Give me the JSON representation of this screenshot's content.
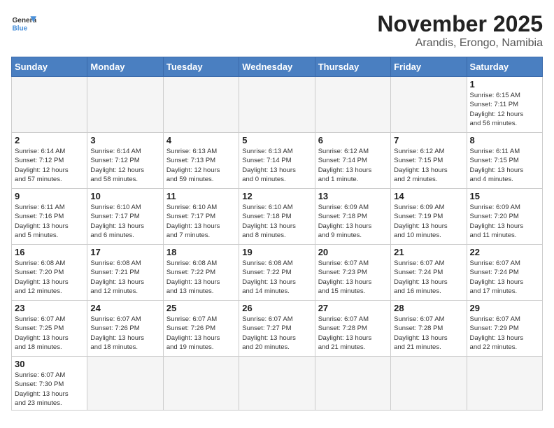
{
  "header": {
    "logo_general": "General",
    "logo_blue": "Blue",
    "month_title": "November 2025",
    "location": "Arandis, Erongo, Namibia"
  },
  "weekdays": [
    "Sunday",
    "Monday",
    "Tuesday",
    "Wednesday",
    "Thursday",
    "Friday",
    "Saturday"
  ],
  "weeks": [
    [
      {
        "day": "",
        "info": ""
      },
      {
        "day": "",
        "info": ""
      },
      {
        "day": "",
        "info": ""
      },
      {
        "day": "",
        "info": ""
      },
      {
        "day": "",
        "info": ""
      },
      {
        "day": "",
        "info": ""
      },
      {
        "day": "1",
        "info": "Sunrise: 6:15 AM\nSunset: 7:11 PM\nDaylight: 12 hours\nand 56 minutes."
      }
    ],
    [
      {
        "day": "2",
        "info": "Sunrise: 6:14 AM\nSunset: 7:12 PM\nDaylight: 12 hours\nand 57 minutes."
      },
      {
        "day": "3",
        "info": "Sunrise: 6:14 AM\nSunset: 7:12 PM\nDaylight: 12 hours\nand 58 minutes."
      },
      {
        "day": "4",
        "info": "Sunrise: 6:13 AM\nSunset: 7:13 PM\nDaylight: 12 hours\nand 59 minutes."
      },
      {
        "day": "5",
        "info": "Sunrise: 6:13 AM\nSunset: 7:14 PM\nDaylight: 13 hours\nand 0 minutes."
      },
      {
        "day": "6",
        "info": "Sunrise: 6:12 AM\nSunset: 7:14 PM\nDaylight: 13 hours\nand 1 minute."
      },
      {
        "day": "7",
        "info": "Sunrise: 6:12 AM\nSunset: 7:15 PM\nDaylight: 13 hours\nand 2 minutes."
      },
      {
        "day": "8",
        "info": "Sunrise: 6:11 AM\nSunset: 7:15 PM\nDaylight: 13 hours\nand 4 minutes."
      }
    ],
    [
      {
        "day": "9",
        "info": "Sunrise: 6:11 AM\nSunset: 7:16 PM\nDaylight: 13 hours\nand 5 minutes."
      },
      {
        "day": "10",
        "info": "Sunrise: 6:10 AM\nSunset: 7:17 PM\nDaylight: 13 hours\nand 6 minutes."
      },
      {
        "day": "11",
        "info": "Sunrise: 6:10 AM\nSunset: 7:17 PM\nDaylight: 13 hours\nand 7 minutes."
      },
      {
        "day": "12",
        "info": "Sunrise: 6:10 AM\nSunset: 7:18 PM\nDaylight: 13 hours\nand 8 minutes."
      },
      {
        "day": "13",
        "info": "Sunrise: 6:09 AM\nSunset: 7:18 PM\nDaylight: 13 hours\nand 9 minutes."
      },
      {
        "day": "14",
        "info": "Sunrise: 6:09 AM\nSunset: 7:19 PM\nDaylight: 13 hours\nand 10 minutes."
      },
      {
        "day": "15",
        "info": "Sunrise: 6:09 AM\nSunset: 7:20 PM\nDaylight: 13 hours\nand 11 minutes."
      }
    ],
    [
      {
        "day": "16",
        "info": "Sunrise: 6:08 AM\nSunset: 7:20 PM\nDaylight: 13 hours\nand 12 minutes."
      },
      {
        "day": "17",
        "info": "Sunrise: 6:08 AM\nSunset: 7:21 PM\nDaylight: 13 hours\nand 12 minutes."
      },
      {
        "day": "18",
        "info": "Sunrise: 6:08 AM\nSunset: 7:22 PM\nDaylight: 13 hours\nand 13 minutes."
      },
      {
        "day": "19",
        "info": "Sunrise: 6:08 AM\nSunset: 7:22 PM\nDaylight: 13 hours\nand 14 minutes."
      },
      {
        "day": "20",
        "info": "Sunrise: 6:07 AM\nSunset: 7:23 PM\nDaylight: 13 hours\nand 15 minutes."
      },
      {
        "day": "21",
        "info": "Sunrise: 6:07 AM\nSunset: 7:24 PM\nDaylight: 13 hours\nand 16 minutes."
      },
      {
        "day": "22",
        "info": "Sunrise: 6:07 AM\nSunset: 7:24 PM\nDaylight: 13 hours\nand 17 minutes."
      }
    ],
    [
      {
        "day": "23",
        "info": "Sunrise: 6:07 AM\nSunset: 7:25 PM\nDaylight: 13 hours\nand 18 minutes."
      },
      {
        "day": "24",
        "info": "Sunrise: 6:07 AM\nSunset: 7:26 PM\nDaylight: 13 hours\nand 18 minutes."
      },
      {
        "day": "25",
        "info": "Sunrise: 6:07 AM\nSunset: 7:26 PM\nDaylight: 13 hours\nand 19 minutes."
      },
      {
        "day": "26",
        "info": "Sunrise: 6:07 AM\nSunset: 7:27 PM\nDaylight: 13 hours\nand 20 minutes."
      },
      {
        "day": "27",
        "info": "Sunrise: 6:07 AM\nSunset: 7:28 PM\nDaylight: 13 hours\nand 21 minutes."
      },
      {
        "day": "28",
        "info": "Sunrise: 6:07 AM\nSunset: 7:28 PM\nDaylight: 13 hours\nand 21 minutes."
      },
      {
        "day": "29",
        "info": "Sunrise: 6:07 AM\nSunset: 7:29 PM\nDaylight: 13 hours\nand 22 minutes."
      }
    ],
    [
      {
        "day": "30",
        "info": "Sunrise: 6:07 AM\nSunset: 7:30 PM\nDaylight: 13 hours\nand 23 minutes."
      },
      {
        "day": "",
        "info": ""
      },
      {
        "day": "",
        "info": ""
      },
      {
        "day": "",
        "info": ""
      },
      {
        "day": "",
        "info": ""
      },
      {
        "day": "",
        "info": ""
      },
      {
        "day": "",
        "info": ""
      }
    ]
  ]
}
